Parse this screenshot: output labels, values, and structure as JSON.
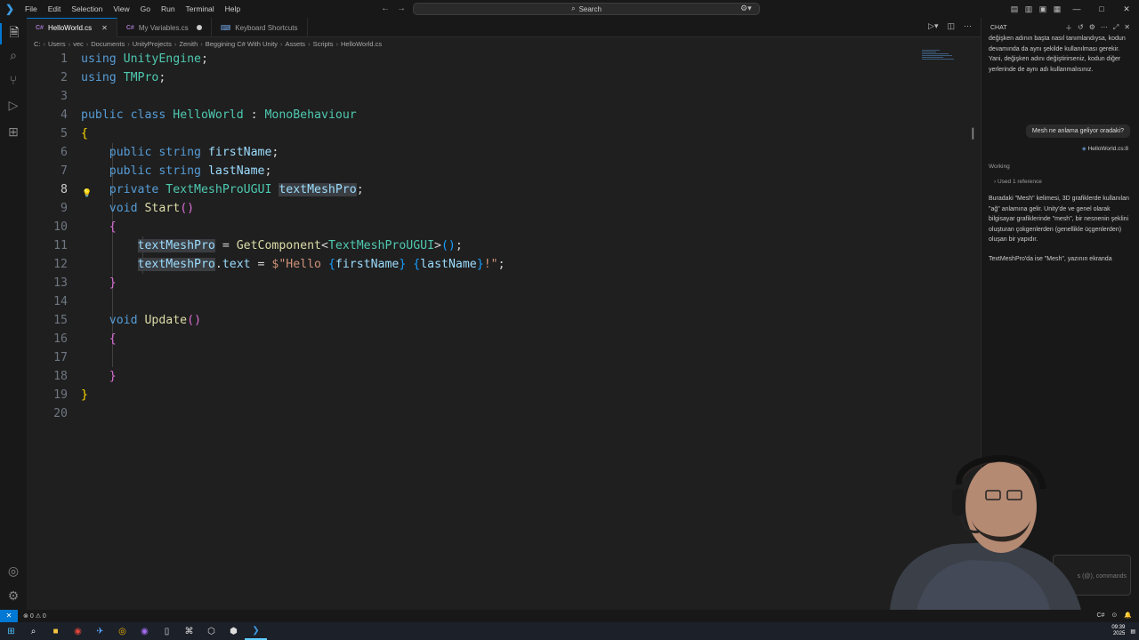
{
  "menu": [
    "File",
    "Edit",
    "Selection",
    "View",
    "Go",
    "Run",
    "Terminal",
    "Help"
  ],
  "search": {
    "label": "Search"
  },
  "tabs": [
    {
      "label": "HelloWorld.cs",
      "icon": "csharp-icon",
      "active": true
    },
    {
      "label": "My Variables.cs",
      "icon": "csharp-icon",
      "modified": true
    },
    {
      "label": "Keyboard Shortcuts",
      "icon": "keyboard-icon"
    }
  ],
  "breadcrumb": [
    "C:",
    "Users",
    "vec",
    "Documents",
    "UnityProjects",
    "Zenith",
    "Beggining C# With Unity",
    "Assets",
    "Scripts",
    "HelloWorld.cs"
  ],
  "code": {
    "current_line": 8,
    "lines": [
      {
        "n": "1",
        "tokens": [
          [
            "kw",
            "using"
          ],
          [
            "pn",
            " "
          ],
          [
            "ty",
            "UnityEngine"
          ],
          [
            "pn",
            ";"
          ]
        ]
      },
      {
        "n": "2",
        "tokens": [
          [
            "kw",
            "using"
          ],
          [
            "pn",
            " "
          ],
          [
            "ty",
            "TMPro"
          ],
          [
            "pn",
            ";"
          ]
        ]
      },
      {
        "n": "3",
        "tokens": []
      },
      {
        "n": "4",
        "tokens": [
          [
            "kw",
            "public"
          ],
          [
            "pn",
            " "
          ],
          [
            "kw",
            "class"
          ],
          [
            "pn",
            " "
          ],
          [
            "ty",
            "HelloWorld"
          ],
          [
            "pn",
            " : "
          ],
          [
            "ty",
            "MonoBehaviour"
          ]
        ]
      },
      {
        "n": "5",
        "tokens": [
          [
            "br1",
            "{"
          ]
        ]
      },
      {
        "n": "6",
        "tokens": [
          [
            "pn",
            "    "
          ],
          [
            "kw",
            "public"
          ],
          [
            "pn",
            " "
          ],
          [
            "kw",
            "string"
          ],
          [
            "pn",
            " "
          ],
          [
            "va",
            "firstName"
          ],
          [
            "pn",
            ";"
          ]
        ]
      },
      {
        "n": "7",
        "tokens": [
          [
            "pn",
            "    "
          ],
          [
            "kw",
            "public"
          ],
          [
            "pn",
            " "
          ],
          [
            "kw",
            "string"
          ],
          [
            "pn",
            " "
          ],
          [
            "va",
            "lastName"
          ],
          [
            "pn",
            ";"
          ]
        ]
      },
      {
        "n": "8",
        "tokens": [
          [
            "pn",
            "    "
          ],
          [
            "kw",
            "private"
          ],
          [
            "pn",
            " "
          ],
          [
            "ty",
            "TextMeshProUGUI"
          ],
          [
            "pn",
            " "
          ],
          [
            "va hl",
            "textMeshPro"
          ],
          [
            "pn",
            ";"
          ]
        ]
      },
      {
        "n": "9",
        "tokens": [
          [
            "pn",
            "    "
          ],
          [
            "kw",
            "void"
          ],
          [
            "pn",
            " "
          ],
          [
            "fn",
            "Start"
          ],
          [
            "br2",
            "()"
          ]
        ]
      },
      {
        "n": "10",
        "tokens": [
          [
            "pn",
            "    "
          ],
          [
            "br2",
            "{"
          ]
        ]
      },
      {
        "n": "11",
        "tokens": [
          [
            "pn",
            "        "
          ],
          [
            "va hl",
            "textMeshPro"
          ],
          [
            "pn",
            " = "
          ],
          [
            "fn",
            "GetComponent"
          ],
          [
            "pn",
            "<"
          ],
          [
            "ty",
            "TextMeshProUGUI"
          ],
          [
            "pn",
            ">"
          ],
          [
            "br3",
            "()"
          ],
          [
            "pn",
            ";"
          ]
        ]
      },
      {
        "n": "12",
        "tokens": [
          [
            "pn",
            "        "
          ],
          [
            "va hl",
            "textMeshPro"
          ],
          [
            "pn",
            "."
          ],
          [
            "va",
            "text"
          ],
          [
            "pn",
            " = "
          ],
          [
            "st",
            "$\"Hello "
          ],
          [
            "br3",
            "{"
          ],
          [
            "va",
            "firstName"
          ],
          [
            "br3",
            "}"
          ],
          [
            "st",
            " "
          ],
          [
            "br3",
            "{"
          ],
          [
            "va",
            "lastName"
          ],
          [
            "br3",
            "}"
          ],
          [
            "st",
            "!\""
          ],
          [
            "pn",
            ";"
          ]
        ]
      },
      {
        "n": "13",
        "tokens": [
          [
            "pn",
            "    "
          ],
          [
            "br2",
            "}"
          ]
        ]
      },
      {
        "n": "14",
        "tokens": []
      },
      {
        "n": "15",
        "tokens": [
          [
            "pn",
            "    "
          ],
          [
            "kw",
            "void"
          ],
          [
            "pn",
            " "
          ],
          [
            "fn",
            "Update"
          ],
          [
            "br2",
            "()"
          ]
        ]
      },
      {
        "n": "16",
        "tokens": [
          [
            "pn",
            "    "
          ],
          [
            "br2",
            "{"
          ]
        ]
      },
      {
        "n": "17",
        "tokens": []
      },
      {
        "n": "18",
        "tokens": [
          [
            "pn",
            "    "
          ],
          [
            "br2",
            "}"
          ]
        ]
      },
      {
        "n": "19",
        "tokens": [
          [
            "br1",
            "}"
          ]
        ]
      },
      {
        "n": "20",
        "tokens": []
      }
    ]
  },
  "chat": {
    "title": "CHAT",
    "prev_answer_tail": "değişken adının başta nasıl tanımlandıysa, kodun devamında da aynı şekilde kullanılması gerekir. Yani, değişken adını değiştirirseniz, kodun diğer yerlerinde de aynı adı kullanmalısınız.",
    "user_message": "Mesh ne anlama geliyor oradaki?",
    "ref_file": "HelloWorld.cs:8",
    "working_label": "Working",
    "used_refs": "Used 1 reference",
    "answer_p1": "Buradaki \"Mesh\" kelimesi, 3D grafiklerde kullanılan \"ağ\" anlamına gelir. Unity'de ve genel olarak bilgisayar grafiklerinde \"mesh\", bir nesnenin şeklini oluşturan çokgenlerden (genellikle üçgenlerden) oluşan bir yapıdır.",
    "answer_p2": "TextMeshPro'da ise \"Mesh\", yazının ekranda",
    "input_hint": "s (@), commands"
  },
  "status": {
    "errors": "0",
    "warnings": "0",
    "language": "C#"
  },
  "taskbar": {
    "time": "09:39",
    "date": "2025"
  }
}
